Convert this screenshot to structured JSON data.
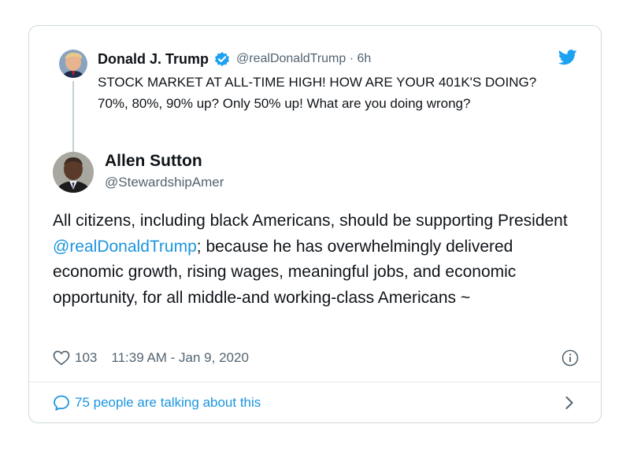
{
  "quoted_tweet": {
    "author_name": "Donald J. Trump",
    "handle": "@realDonaldTrump",
    "separator": "·",
    "age": "6h",
    "text": "STOCK MARKET AT ALL-TIME HIGH! HOW ARE YOUR 401K'S DOING? 70%, 80%, 90% up? Only 50% up! What are you doing wrong?",
    "verified_icon": "verified-badge-icon"
  },
  "tweet": {
    "author_name": "Allen Sutton",
    "handle": "@StewardshipAmer",
    "text_before_mention": "All citizens, including black Americans, should be supporting President ",
    "mention": "@realDonaldTrump",
    "text_after_mention": "; because he has overwhelmingly delivered economic growth, rising wages, meaningful jobs, and economic opportunity, for all middle-and working-class Americans ~",
    "like_count": "103",
    "timestamp": "11:39 AM - Jan 9, 2020"
  },
  "footer": {
    "talking_text": "75 people are talking about this"
  },
  "colors": {
    "accent": "#1b95e0",
    "twitter_blue": "#1da1f2",
    "text": "#0f1419",
    "secondary": "#536471",
    "border": "#cfd9de"
  },
  "icons": {
    "brand": "twitter-bird-icon",
    "like": "heart-icon",
    "info": "info-icon",
    "conversation": "speech-bubble-icon",
    "navigate": "chevron-right-icon"
  }
}
